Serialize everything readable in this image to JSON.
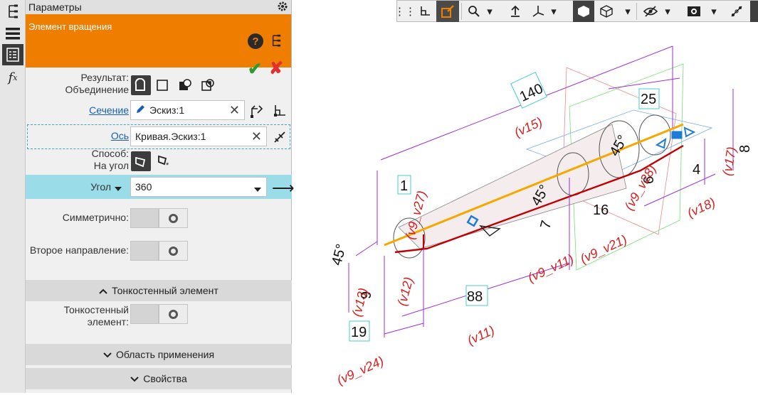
{
  "leftbar": {
    "icons": [
      "tree-icon",
      "menu-icon",
      "properties-icon",
      "function-icon"
    ]
  },
  "panel": {
    "title": "Параметры",
    "operation_title": "Элемент вращения",
    "result": {
      "label_line1": "Результат:",
      "label_line2": "Объединение"
    },
    "section_field": {
      "label": "Сечение",
      "value": "Эскиз:1"
    },
    "axis_field": {
      "label": "Ось",
      "value": "Кривая.Эскиз:1"
    },
    "method": {
      "label_line1": "Способ:",
      "label_line2": "На угол"
    },
    "angle": {
      "label": "Угол",
      "value": "360"
    },
    "symmetric": {
      "label": "Симметрично:",
      "on": false
    },
    "second_direction": {
      "label": "Второе направление:",
      "on": false
    },
    "thin_section": {
      "header": "Тонкостенный элемент",
      "label_line1": "Тонкостенный",
      "label_line2": "элемент:",
      "on": false
    },
    "scope_section": {
      "header": "Область применения"
    },
    "properties_section": {
      "header": "Свойства"
    }
  },
  "drawing": {
    "dimensions": [
      "140",
      "25",
      "1",
      "88",
      "19",
      "9",
      "6",
      "7",
      "8",
      "4",
      "45°",
      "45°",
      "45°",
      "16"
    ],
    "labels": [
      "(v15)",
      "(v9_v24)",
      "(v9_v27)",
      "(v12)",
      "(v13)",
      "(v11)",
      "(v9_v11)",
      "(v9_v21)",
      "(v18)",
      "(v17)",
      "(v9_v28)"
    ]
  },
  "colors": {
    "accent": "#ef7d00",
    "dim_line": "#9b30d9",
    "dim_text": "#d42020",
    "axis": "#f5a800",
    "edge": "#c00000"
  }
}
